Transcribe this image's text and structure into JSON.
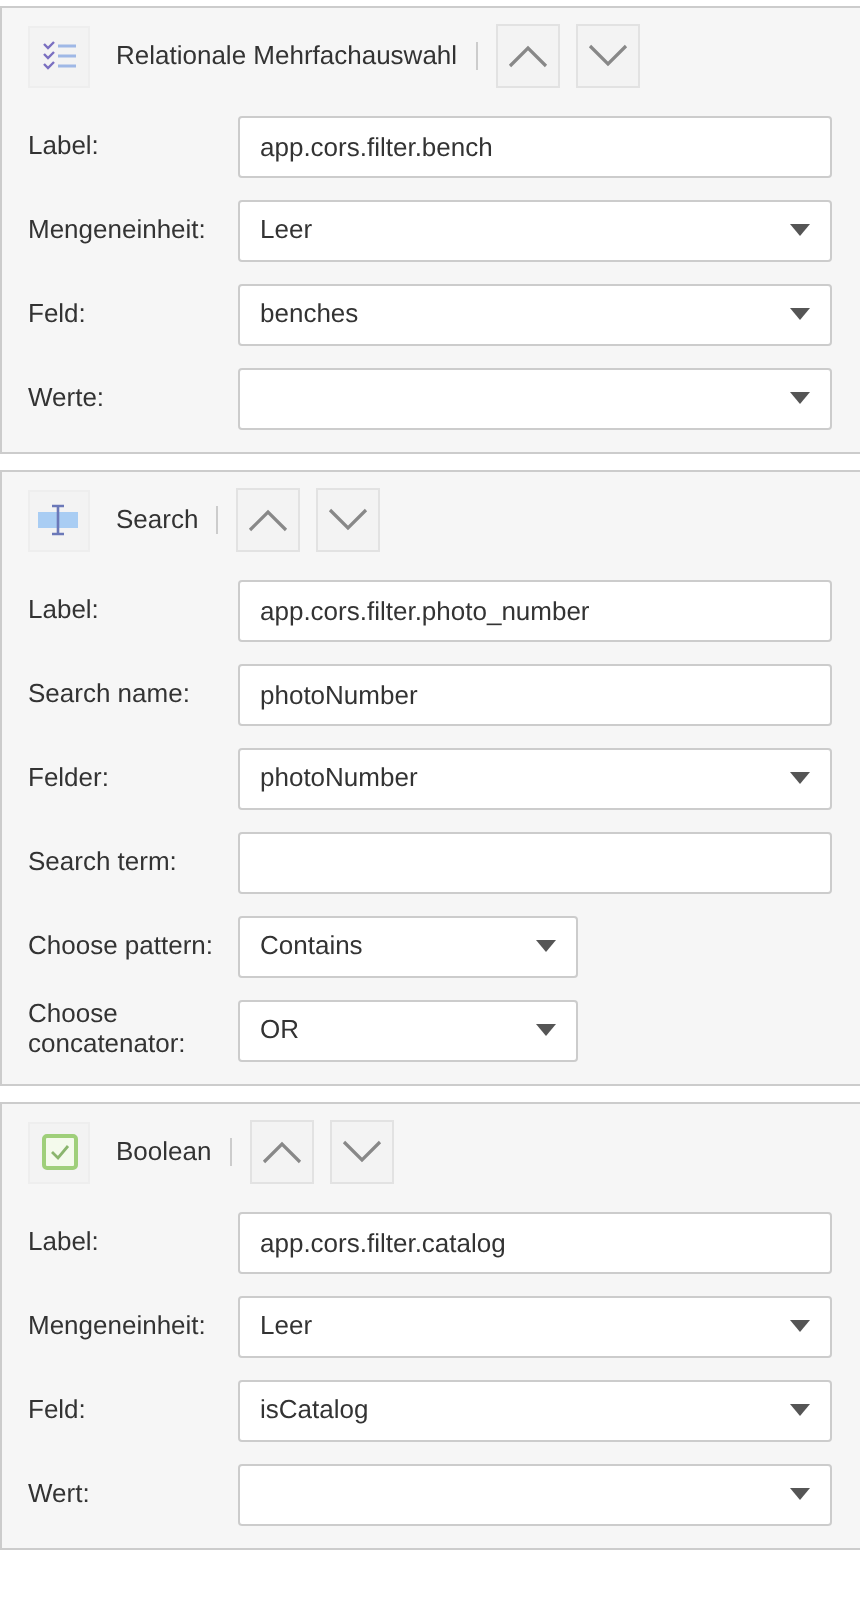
{
  "panels": [
    {
      "kind": "relational",
      "title": "Relationale Mehrfachauswahl",
      "fields": [
        {
          "label": "Label:",
          "kind": "text",
          "value": "app.cors.filter.bench"
        },
        {
          "label": "Mengeneinheit:",
          "kind": "select",
          "value": "Leer"
        },
        {
          "label": "Feld:",
          "kind": "select",
          "value": "benches"
        },
        {
          "label": "Werte:",
          "kind": "select"
        }
      ]
    },
    {
      "kind": "search",
      "title": "Search",
      "fields": [
        {
          "label": "Label:",
          "kind": "text",
          "value": "app.cors.filter.photo_number"
        },
        {
          "label": "Search name:",
          "kind": "text",
          "value": "photoNumber"
        },
        {
          "label": "Felder:",
          "kind": "select",
          "value": "photoNumber"
        },
        {
          "label": "Search term:",
          "kind": "text"
        },
        {
          "label": "Choose pattern:",
          "kind": "narrow",
          "value": "Contains"
        },
        {
          "label": "Choose concatenator:",
          "kind": "narrow",
          "value": "OR"
        }
      ]
    },
    {
      "kind": "boolean",
      "title": "Boolean",
      "fields": [
        {
          "label": "Label:",
          "kind": "text",
          "value": "app.cors.filter.catalog"
        },
        {
          "label": "Mengeneinheit:",
          "kind": "select",
          "value": "Leer"
        },
        {
          "label": "Feld:",
          "kind": "select",
          "value": "isCatalog"
        },
        {
          "label": "Wert:",
          "kind": "select"
        }
      ]
    }
  ]
}
